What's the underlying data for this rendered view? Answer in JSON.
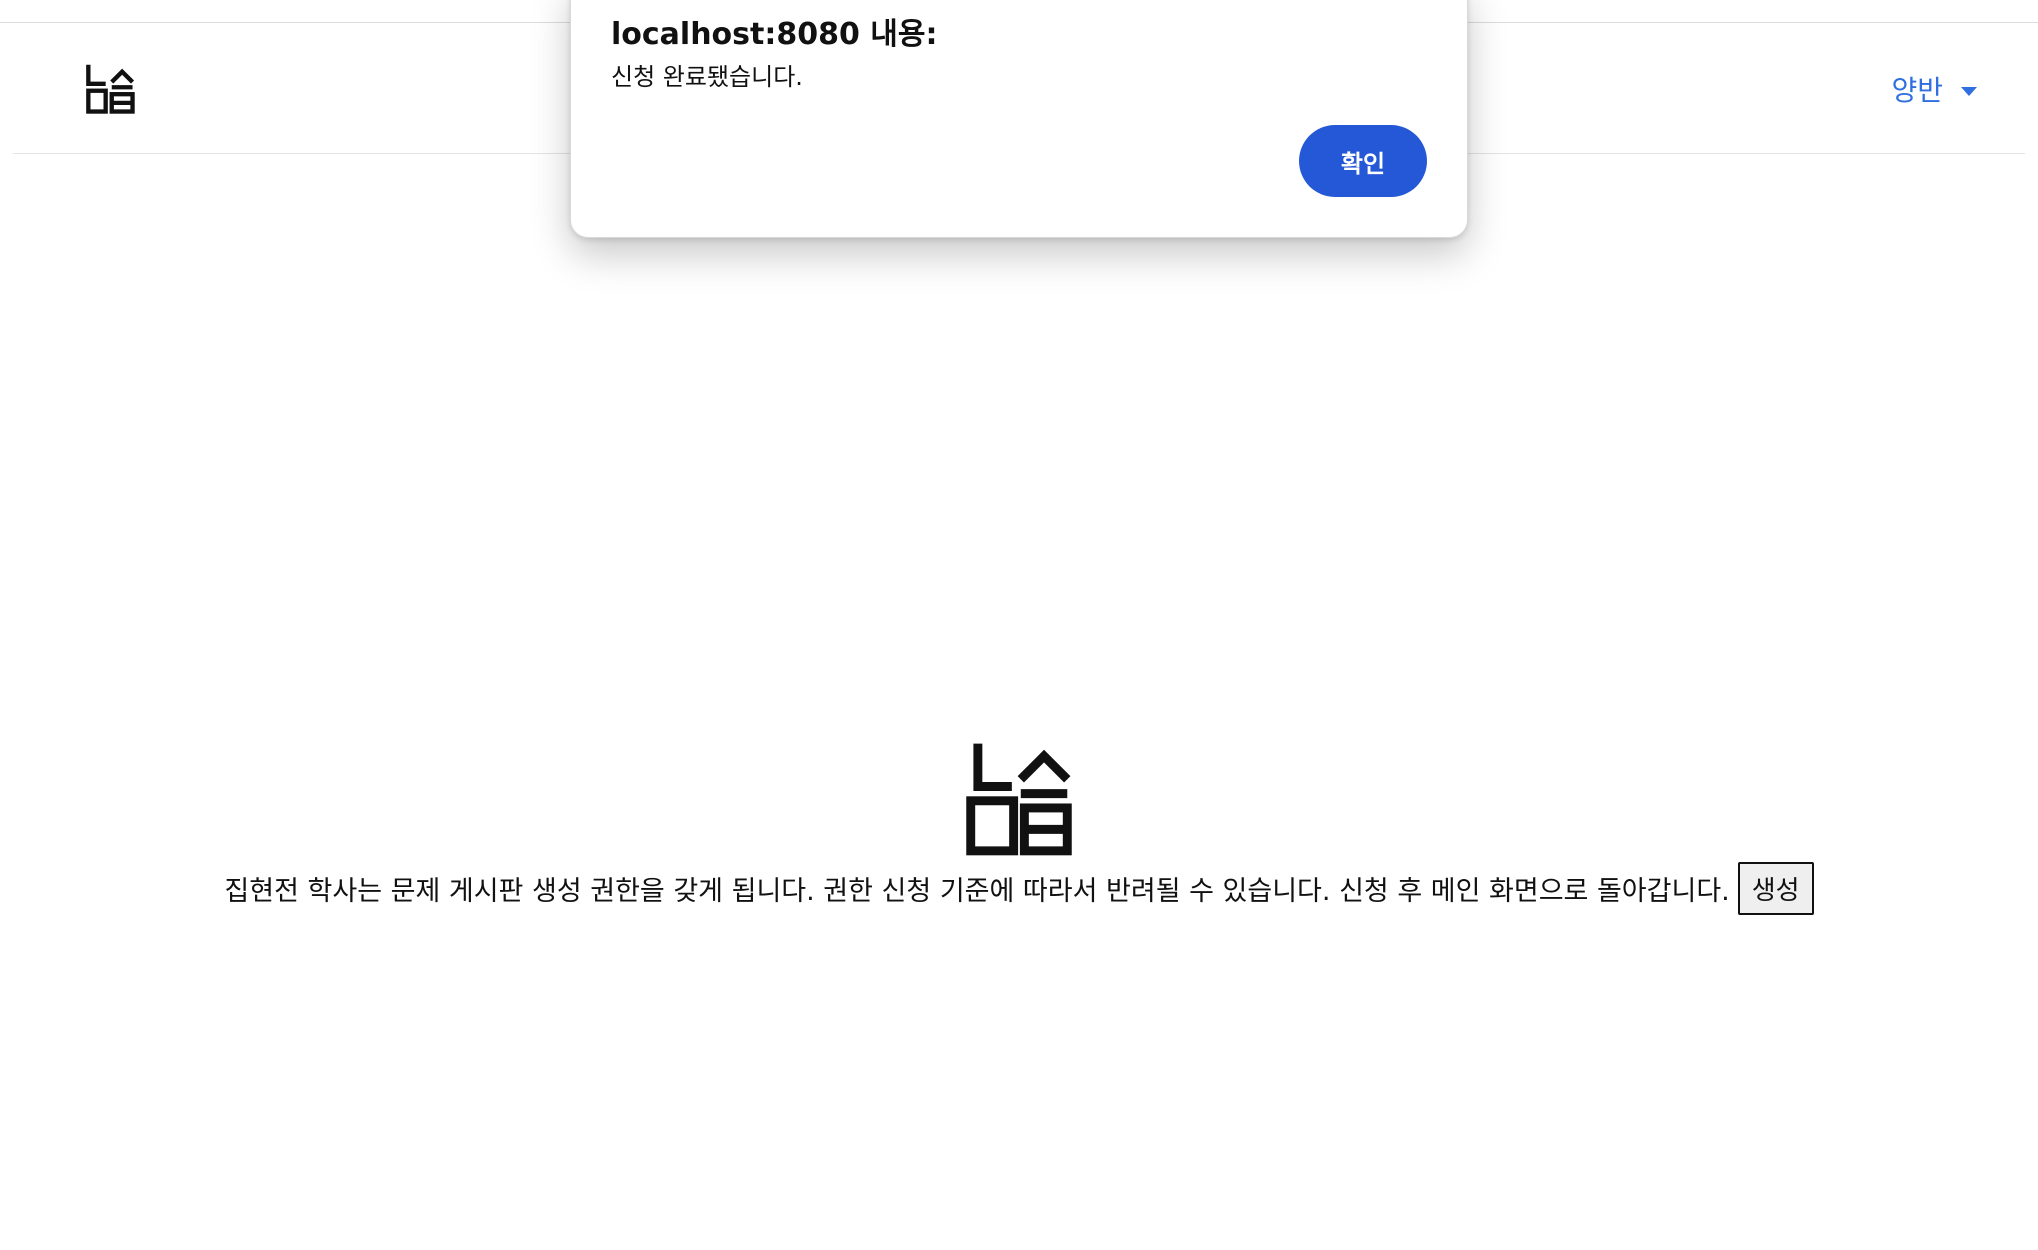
{
  "header": {
    "logo_icon": "jiphyeonjeon-logo-icon",
    "user_menu_label": "양반",
    "accent_color": "#2f6fe0"
  },
  "main": {
    "logo_icon": "jiphyeonjeon-logo-icon",
    "description": "집현전 학사는 문제 게시판 생성 권한을 갖게 됩니다. 권한 신청 기준에 따라서 반려될 수 있습니다. 신청 후 메인 화면으로 돌아갑니다.",
    "create_button_label": "생성"
  },
  "dialog": {
    "title": "localhost:8080 내용:",
    "message": "신청 완료됐습니다.",
    "ok_label": "확인",
    "ok_color": "#2558d6"
  }
}
